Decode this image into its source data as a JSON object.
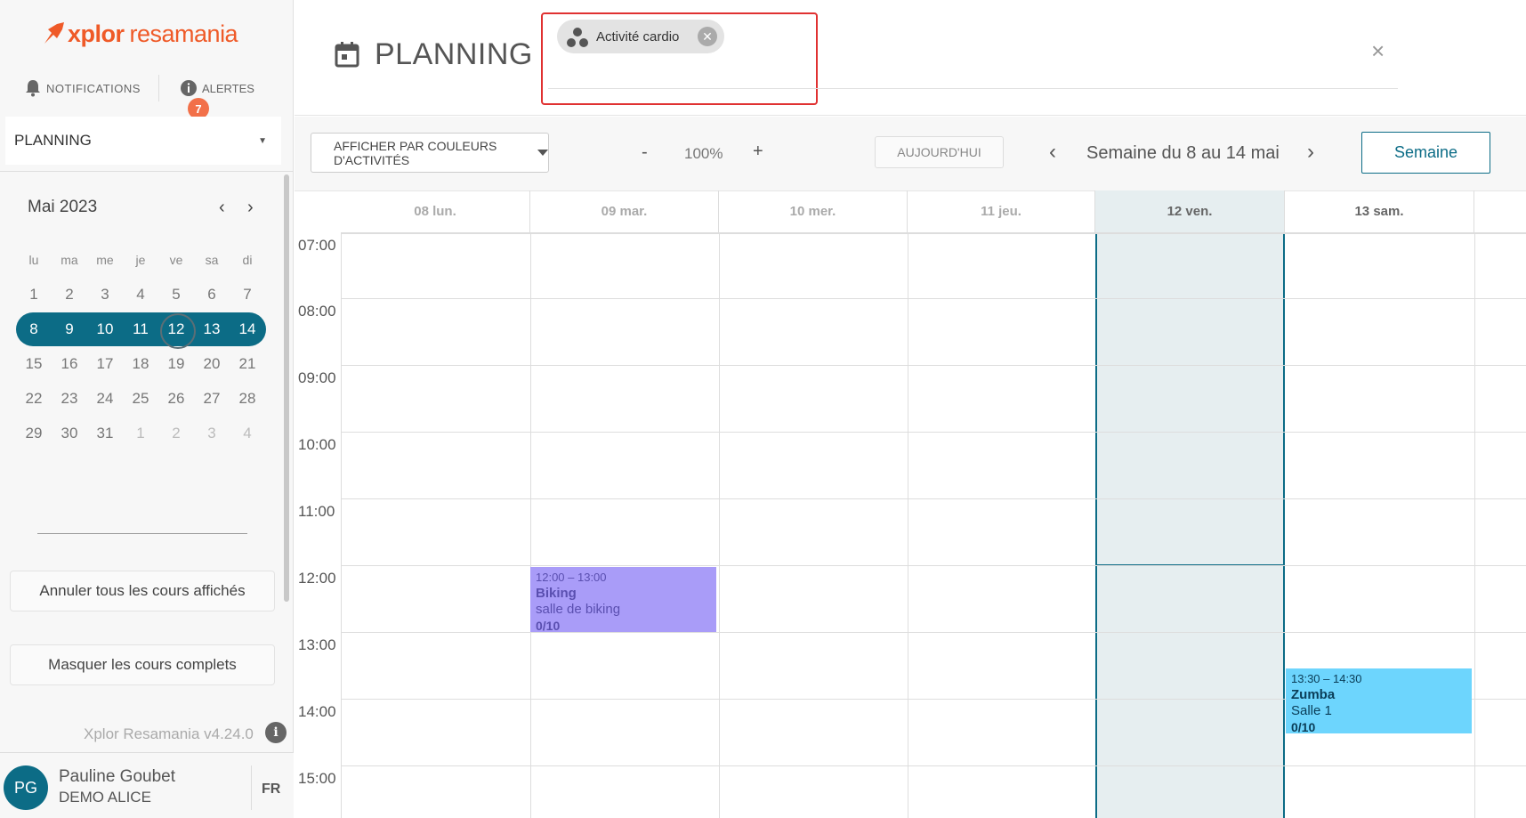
{
  "sidebar": {
    "logo": {
      "brand": "xplor",
      "name": "resamania"
    },
    "notifications_label": "NOTIFICATIONS",
    "alerts_label": "ALERTES",
    "alerts_count": "7",
    "planning_select": "PLANNING",
    "calendar": {
      "month_label": "Mai 2023",
      "weekdays": [
        "lu",
        "ma",
        "me",
        "je",
        "ve",
        "sa",
        "di"
      ],
      "weeks": [
        [
          "1",
          "2",
          "3",
          "4",
          "5",
          "6",
          "7"
        ],
        [
          "8",
          "9",
          "10",
          "11",
          "12",
          "13",
          "14"
        ],
        [
          "15",
          "16",
          "17",
          "18",
          "19",
          "20",
          "21"
        ],
        [
          "22",
          "23",
          "24",
          "25",
          "26",
          "27",
          "28"
        ],
        [
          "29",
          "30",
          "31",
          "1",
          "2",
          "3",
          "4"
        ]
      ]
    },
    "cancel_all_button": "Annuler tous les cours affichés",
    "hide_full_button": "Masquer les cours complets",
    "version": "Xplor Resamania v4.24.0",
    "user": {
      "initials": "PG",
      "name": "Pauline Goubet",
      "org": "DEMO ALICE",
      "lang": "FR"
    }
  },
  "header": {
    "title": "PLANNING",
    "filter_chip": "Activité cardio"
  },
  "toolbar": {
    "color_button": "AFFICHER PAR COULEURS D'ACTIVITÉS",
    "zoom_minus": "-",
    "zoom_value": "100%",
    "zoom_plus": "+",
    "today_button": "AUJOURD'HUI",
    "week_label": "Semaine du 8 au 14 mai",
    "view_button": "Semaine"
  },
  "grid": {
    "days": [
      "08 lun.",
      "09 mar.",
      "10 mer.",
      "11 jeu.",
      "12 ven.",
      "13 sam."
    ],
    "hours": [
      "07:00",
      "08:00",
      "09:00",
      "10:00",
      "11:00",
      "12:00",
      "13:00",
      "14:00",
      "15:00"
    ],
    "events": [
      {
        "time": "12:00 – 13:00",
        "title": "Biking",
        "room": "salle de biking",
        "capacity": "0/10",
        "color": "#a99cf8"
      },
      {
        "time": "13:30 – 14:30",
        "title": "Zumba",
        "room": "Salle 1",
        "capacity": "0/10",
        "color": "#6dd5fd"
      }
    ]
  },
  "colors": {
    "accent": "#0c6c86",
    "brand": "#ef5a28",
    "highlight_border": "#e03131"
  }
}
